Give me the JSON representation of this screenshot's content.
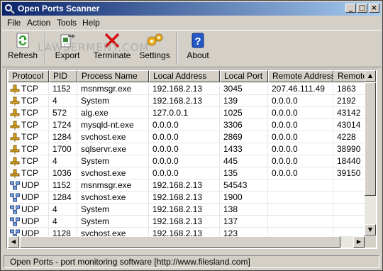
{
  "window": {
    "title": "Open Ports Scanner"
  },
  "menu": [
    "File",
    "Action",
    "Tools",
    "Help"
  ],
  "toolbar": {
    "refresh": "Refresh",
    "export": "Export",
    "terminate": "Terminate",
    "settings": "Settings",
    "about": "About"
  },
  "watermark": "LAWSERMENT.COM",
  "columns": [
    "Protocol",
    "PID",
    "Process Name",
    "Local Address",
    "Local Port",
    "Remote Address",
    "Remote"
  ],
  "rows": [
    [
      "TCP",
      "1152",
      "msnmsgr.exe",
      "192.168.2.13",
      "3045",
      "207.46.111.49",
      "1863"
    ],
    [
      "TCP",
      "4",
      "System",
      "192.168.2.13",
      "139",
      "0.0.0.0",
      "2192"
    ],
    [
      "TCP",
      "572",
      "alg.exe",
      "127.0.0.1",
      "1025",
      "0.0.0.0",
      "43142"
    ],
    [
      "TCP",
      "1724",
      "mysqld-nt.exe",
      "0.0.0.0",
      "3306",
      "0.0.0.0",
      "43014"
    ],
    [
      "TCP",
      "1284",
      "svchost.exe",
      "0.0.0.0",
      "2869",
      "0.0.0.0",
      "4228"
    ],
    [
      "TCP",
      "1700",
      "sqlservr.exe",
      "0.0.0.0",
      "1433",
      "0.0.0.0",
      "38990"
    ],
    [
      "TCP",
      "4",
      "System",
      "0.0.0.0",
      "445",
      "0.0.0.0",
      "18440"
    ],
    [
      "TCP",
      "1036",
      "svchost.exe",
      "0.0.0.0",
      "135",
      "0.0.0.0",
      "39150"
    ],
    [
      "UDP",
      "1152",
      "msnmsgr.exe",
      "192.168.2.13",
      "54543",
      "",
      ""
    ],
    [
      "UDP",
      "1284",
      "svchost.exe",
      "192.168.2.13",
      "1900",
      "",
      ""
    ],
    [
      "UDP",
      "4",
      "System",
      "192.168.2.13",
      "138",
      "",
      ""
    ],
    [
      "UDP",
      "4",
      "System",
      "192.168.2.13",
      "137",
      "",
      ""
    ],
    [
      "UDP",
      "1128",
      "svchost.exe",
      "192.168.2.13",
      "123",
      "",
      ""
    ]
  ],
  "status": "Open Ports - port monitoring software  [http://www.filesland.com]",
  "colors": {
    "title_start": "#0a246a",
    "title_end": "#a6caf0",
    "face": "#d4d0c8"
  },
  "icons": {
    "refresh": "refresh-icon",
    "export": "export-icon",
    "terminate": "terminate-icon",
    "settings": "settings-icon",
    "about": "about-icon",
    "tcp": "tcp-plug-icon",
    "udp": "udp-network-icon"
  }
}
